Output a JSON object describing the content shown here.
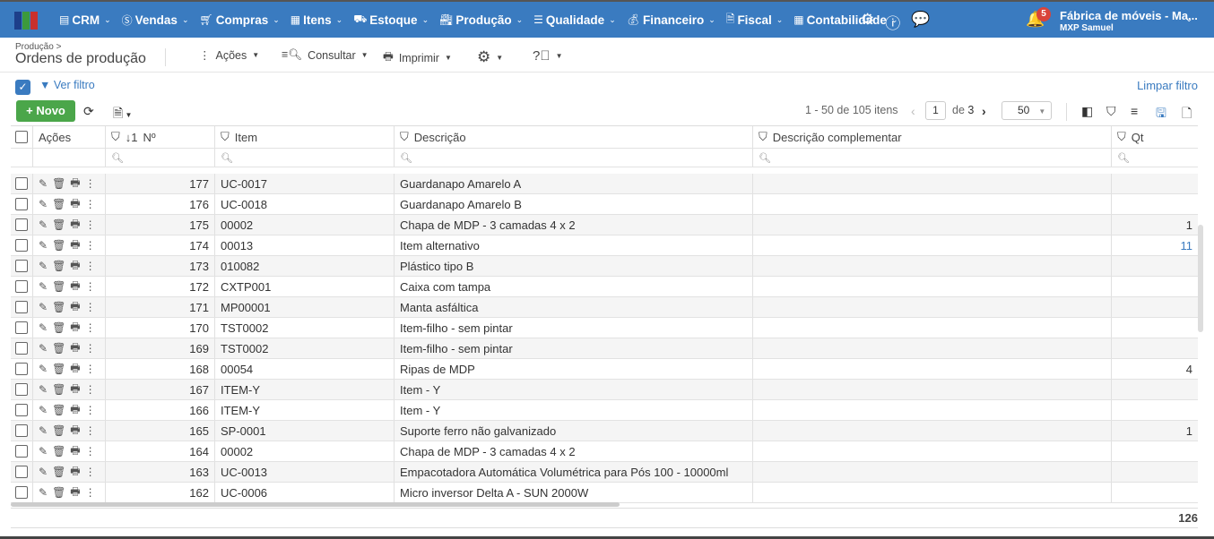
{
  "topbar": {
    "menu": [
      {
        "label": "CRM",
        "icon": "crm-icon"
      },
      {
        "label": "Vendas",
        "icon": "dollar-icon"
      },
      {
        "label": "Compras",
        "icon": "cart-icon"
      },
      {
        "label": "Itens",
        "icon": "items-icon"
      },
      {
        "label": "Estoque",
        "icon": "stock-icon"
      },
      {
        "label": "Produção",
        "icon": "factory-icon"
      },
      {
        "label": "Qualidade",
        "icon": "checklist-icon"
      },
      {
        "label": "Financeiro",
        "icon": "money-bag-icon"
      },
      {
        "label": "Fiscal",
        "icon": "document-icon"
      },
      {
        "label": "Contabilidade",
        "icon": "calculator-icon"
      }
    ],
    "notifications": "5",
    "company": "Fábrica de móveis - Ma...",
    "user": "MXP Samuel",
    "colors": {
      "bar": "#3a7bc0",
      "badge": "#d9443a"
    }
  },
  "header": {
    "breadcrumb": "Produção >",
    "title": "Ordens de produção",
    "acoes": "Ações",
    "consultar": "Consultar",
    "imprimir": "Imprimir"
  },
  "filter": {
    "ver": "Ver filtro",
    "limpar": "Limpar filtro"
  },
  "toolbar": {
    "novo": "Novo",
    "range": "1 - 50 de 105 itens",
    "page": "1",
    "of": "de",
    "pages": "3",
    "page_size": "50"
  },
  "columns": {
    "acoes": "Ações",
    "sort": "↓1",
    "num": "Nº",
    "item": "Item",
    "desc": "Descrição",
    "desc_comp": "Descrição complementar",
    "qt": "Qt"
  },
  "rows": [
    {
      "num": "177",
      "item": "UC-0017",
      "desc": "Guardanapo Amarelo A",
      "qt": ""
    },
    {
      "num": "176",
      "item": "UC-0018",
      "desc": "Guardanapo Amarelo B",
      "qt": ""
    },
    {
      "num": "175",
      "item": "00002",
      "desc": "Chapa de MDP - 3 camadas 4 x 2",
      "qt": "1"
    },
    {
      "num": "174",
      "item": "00013",
      "desc": "Item alternativo",
      "qt": "11"
    },
    {
      "num": "173",
      "item": "010082",
      "desc": "Plástico tipo B",
      "qt": ""
    },
    {
      "num": "172",
      "item": "CXTP001",
      "desc": "Caixa com tampa",
      "qt": ""
    },
    {
      "num": "171",
      "item": "MP00001",
      "desc": "Manta asfáltica",
      "qt": ""
    },
    {
      "num": "170",
      "item": "TST0002",
      "desc": "Item-filho - sem pintar",
      "qt": ""
    },
    {
      "num": "169",
      "item": "TST0002",
      "desc": "Item-filho - sem pintar",
      "qt": ""
    },
    {
      "num": "168",
      "item": "00054",
      "desc": "Ripas de MDP",
      "qt": "4"
    },
    {
      "num": "167",
      "item": "ITEM-Y",
      "desc": "Item - Y",
      "qt": ""
    },
    {
      "num": "166",
      "item": "ITEM-Y",
      "desc": "Item - Y",
      "qt": ""
    },
    {
      "num": "165",
      "item": "SP-0001",
      "desc": "Suporte ferro não galvanizado",
      "qt": "1"
    },
    {
      "num": "164",
      "item": "00002",
      "desc": "Chapa de MDP - 3 camadas 4 x 2",
      "qt": ""
    },
    {
      "num": "163",
      "item": "UC-0013",
      "desc": "Empacotadora Automática Volumétrica para Pós 100 - 10000ml",
      "qt": ""
    },
    {
      "num": "162",
      "item": "UC-0006",
      "desc": "Micro inversor Delta A - SUN 2000W",
      "qt": ""
    }
  ],
  "footer": {
    "total_qt": "126"
  }
}
